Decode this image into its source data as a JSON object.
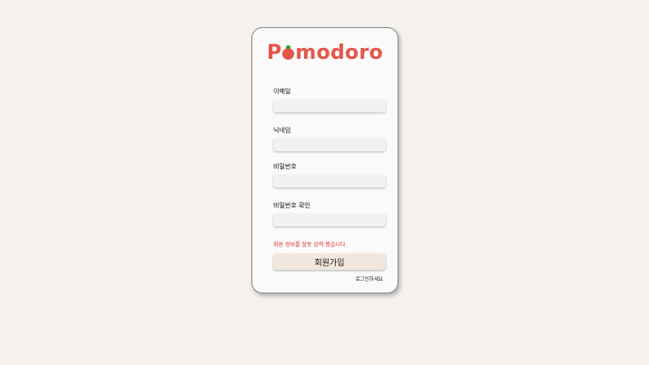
{
  "app": {
    "logo_prefix": "P",
    "logo_suffix": "modoro"
  },
  "form": {
    "email_label": "이메일",
    "email_value": "",
    "nickname_label": "닉네임",
    "nickname_value": "",
    "password_label": "비밀번호",
    "password_value": "",
    "password_confirm_label": "비밀번호 확인",
    "password_confirm_value": "",
    "error_message": "회원 정보를 잘못 입력 했습니다.",
    "submit_label": "회원가입",
    "login_link": "로그인하세요"
  },
  "colors": {
    "brand": "#e4584a",
    "error": "#e0302a",
    "button_bg": "#f1e7de",
    "page_bg": "#f5f1ee"
  }
}
